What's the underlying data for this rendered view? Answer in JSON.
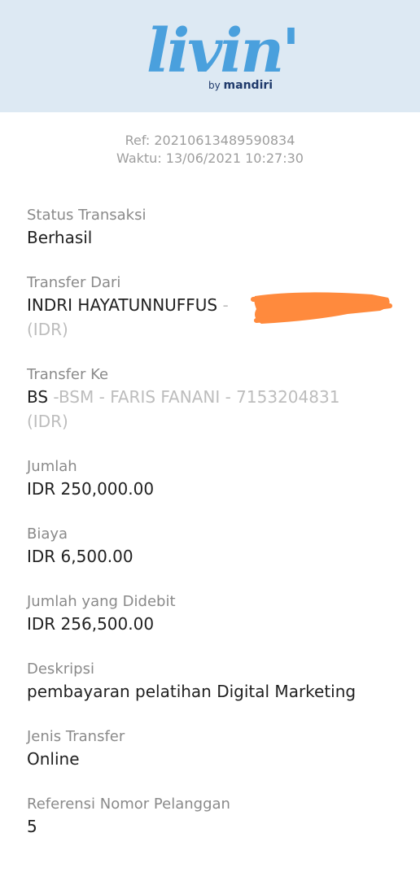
{
  "header": {
    "logo_text": "livin'",
    "by_text": "by",
    "brand_text": "mandiri"
  },
  "receipt": {
    "ref": "Ref: 20210613489590834",
    "time": "Waktu: 13/06/2021 10:27:30"
  },
  "fields": {
    "status": {
      "label": "Status Transaksi",
      "value": "Berhasil"
    },
    "from": {
      "label": "Transfer Dari",
      "name": "INDRI HAYATUNNUFFUS",
      "dash": " -",
      "currency": "(IDR)"
    },
    "to": {
      "label": "Transfer Ke",
      "bank_code": "BS",
      "detail": " -BSM - FARIS FANANI - 7153204831",
      "currency": "(IDR)"
    },
    "amount": {
      "label": "Jumlah",
      "value": "IDR 250,000.00"
    },
    "fee": {
      "label": "Biaya",
      "value": "IDR 6,500.00"
    },
    "debited": {
      "label": "Jumlah yang Didebit",
      "value": "IDR 256,500.00"
    },
    "description": {
      "label": "Deskripsi",
      "value": "pembayaran pelatihan Digital Marketing"
    },
    "transfer_type": {
      "label": "Jenis Transfer",
      "value": "Online"
    },
    "customer_ref": {
      "label": "Referensi Nomor Pelanggan",
      "value": "5"
    }
  },
  "colors": {
    "header_bg": "#dde9f3",
    "logo_blue": "#4aa0dd",
    "logo_accent": "#f5b400",
    "brand_navy": "#1f3a6b",
    "redaction": "#ff8a3d"
  }
}
